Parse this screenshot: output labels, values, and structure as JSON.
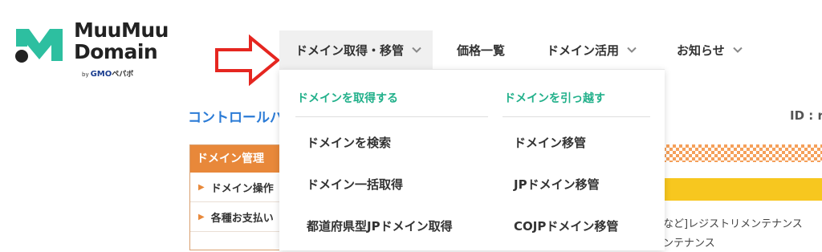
{
  "logo": {
    "line1": "MuuMuu",
    "line2": "Domain",
    "by": "by",
    "gmo": "GMO",
    "pepabo": "ペパボ",
    "mark_color": "#2dbfa0"
  },
  "nav": {
    "items": [
      {
        "label": "ドメイン取得・移管",
        "has_chevron": true,
        "active": true
      },
      {
        "label": "価格一覧",
        "has_chevron": false
      },
      {
        "label": "ドメイン活用",
        "has_chevron": true
      },
      {
        "label": "お知らせ",
        "has_chevron": true
      }
    ]
  },
  "dropdown": {
    "col1": {
      "heading": "ドメインを取得する",
      "items": [
        "ドメインを検索",
        "ドメイン一括取得",
        "都道府県型JPドメイン取得"
      ]
    },
    "col2": {
      "heading": "ドメインを引っ越す",
      "items": [
        "ドメイン移管",
        "JPドメイン移管",
        "COJPドメイン移管"
      ]
    }
  },
  "page": {
    "control_link": "コントロールパ",
    "id_label": "ID : r",
    "panel_heading": "ドメイン管理",
    "panel_rows": [
      "ドメイン操作",
      "各種お支払い"
    ],
    "maintenance_line1": "など]レジストリメンテナンス",
    "maintenance_line2": "ンテナンス"
  },
  "colors": {
    "accent_green": "#21b08a",
    "arrow_red": "#e52620",
    "link_blue": "#2b7bd6",
    "panel_orange": "#e8883a",
    "banner_yellow": "#f7c71f"
  }
}
